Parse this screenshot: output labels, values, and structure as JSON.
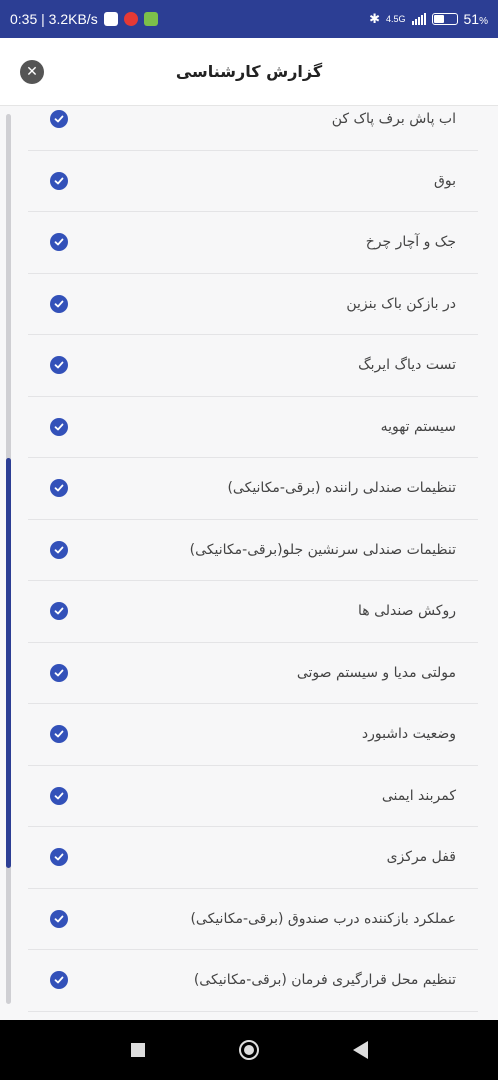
{
  "status_bar": {
    "time_speed": "0:35 | 3.2KB/s",
    "network": "4.5G",
    "battery": "51",
    "battery_unit": "%",
    "battery_fraction": 0.51
  },
  "header": {
    "title": "گزارش کارشناسی",
    "close_symbol": "✕"
  },
  "items": [
    {
      "label": "اب پاش برف پاک کن"
    },
    {
      "label": "بوق"
    },
    {
      "label": "جک و آچار چرخ"
    },
    {
      "label": "در بازکن باک بنزین"
    },
    {
      "label": "تست دیاگ ایربگ"
    },
    {
      "label": "سیستم تهویه"
    },
    {
      "label": "تنظیمات صندلی راننده (برقی-مکانیکی)"
    },
    {
      "label": "تنظیمات صندلی سرنشین جلو(برقی-مکانیکی)"
    },
    {
      "label": "روکش صندلی ها"
    },
    {
      "label": "مولتی مدیا و سیستم صوتی"
    },
    {
      "label": "وضعیت داشبورد"
    },
    {
      "label": "کمربند ایمنی"
    },
    {
      "label": "قفل مرکزی"
    },
    {
      "label": "عملکرد بازکننده درب صندوق (برقی-مکانیکی)"
    },
    {
      "label": "تنظیم محل قرارگیری فرمان (برقی-مکانیکی)"
    }
  ],
  "colors": {
    "accent": "#2c3e94",
    "check": "#3351b9"
  }
}
